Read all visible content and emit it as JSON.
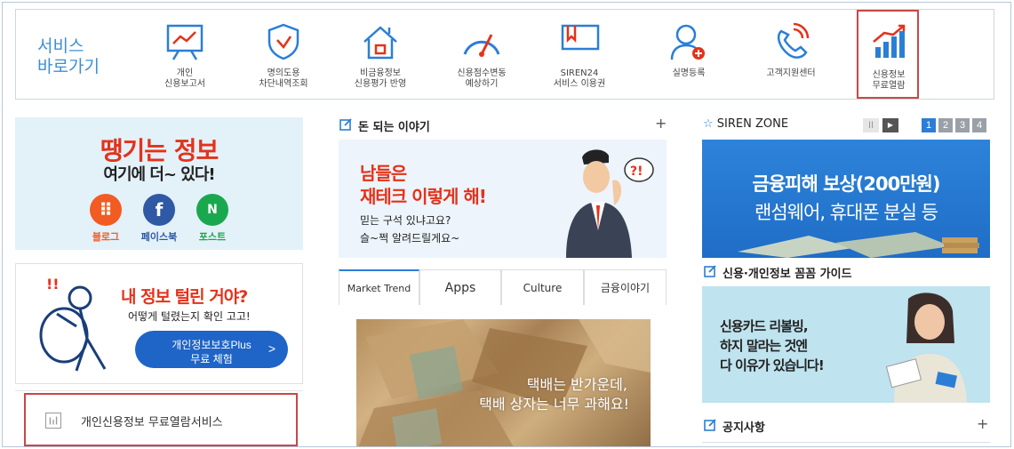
{
  "shortcuts": {
    "title_line1": "서비스",
    "title_line2": "바로가기",
    "items": [
      {
        "label": "개인\n신용보고서",
        "icon": "report-chart-icon"
      },
      {
        "label": "명의도용\n차단내역조회",
        "icon": "shield-check-icon"
      },
      {
        "label": "비금융정보\n신용평가 반영",
        "icon": "house-icon"
      },
      {
        "label": "신용점수변동\n예상하기",
        "icon": "gauge-icon"
      },
      {
        "label": "SIREN24\n서비스 이용권",
        "icon": "ticket-icon"
      },
      {
        "label": "실명등록",
        "icon": "user-add-icon"
      },
      {
        "label": "고객지원센터",
        "icon": "phone-support-icon"
      },
      {
        "label": "신용정보\n무료열람",
        "icon": "bar-growth-icon"
      }
    ]
  },
  "left": {
    "sns_title": "땡기는 정보",
    "sns_subtitle": "여기에 더~ 있다!",
    "sns": [
      {
        "label": "블로그",
        "color": "#f25b22",
        "icon": "blog-icon"
      },
      {
        "label": "페이스북",
        "color": "#2f58a5",
        "icon": "facebook-icon"
      },
      {
        "label": "포스트",
        "color": "#1aa84e",
        "icon": "naver-post-icon"
      }
    ],
    "leak_title": "내 정보 털린 거야?",
    "leak_subtitle": "어떻게 털렸는지 확인 고고!",
    "leak_button_line1": "개인정보보호Plus",
    "leak_button_line2": "무료 체험",
    "leak_button_arrow": ">",
    "free_service": "개인신용정보 무료열람서비스"
  },
  "middle": {
    "section_title": "돈 되는 이야기",
    "section_plus": "+",
    "banner_line1": "남들은",
    "banner_line2": "재테크 이렇게 해!",
    "banner_sub1": "믿는 구석 있냐고요?",
    "banner_sub2": "슬~쩍 알려드릴게요~",
    "bubble": "?!",
    "tabs": [
      "Market Trend",
      "Apps",
      "Culture",
      "금융이야기"
    ],
    "market_line1": "택배는 반가운데,",
    "market_line2": "택배 상자는 너무 과해요!"
  },
  "right": {
    "zone_title": "SIREN ZONE",
    "pager_pause": "II",
    "pager_next": "▶",
    "pages": [
      "1",
      "2",
      "3",
      "4"
    ],
    "siren_line1": "금융피해 보상(200만원)",
    "siren_line2": "랜섬웨어, 휴대폰 분실 등",
    "guide_title": "신용·개인정보 꼼꼼 가이드",
    "guide_line1": "신용카드 리볼빙,",
    "guide_line2": "하지 말라는 것엔",
    "guide_line3": "다 이유가 있습니다!",
    "notice_title": "공지사항",
    "notice_plus": "+"
  },
  "colors": {
    "accent_blue": "#2b7ed6",
    "brand_red": "#e4321a",
    "highlight_red": "#c94747"
  }
}
